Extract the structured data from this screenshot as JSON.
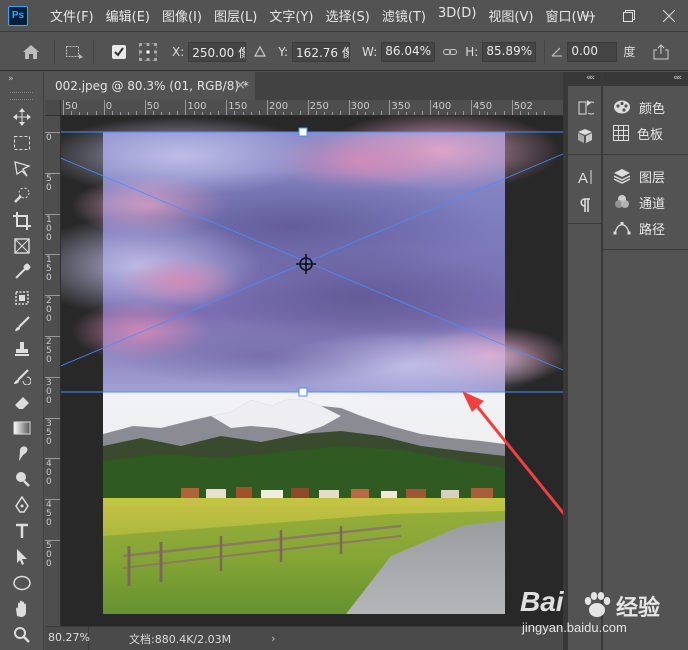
{
  "app": {
    "logo_text": "Ps"
  },
  "menu": [
    "文件(F)",
    "编辑(E)",
    "图像(I)",
    "图层(L)",
    "文字(Y)",
    "选择(S)",
    "滤镜(T)",
    "3D(D)",
    "视图(V)",
    "窗口(W)"
  ],
  "options": {
    "x_label": "X:",
    "x_value": "250.00 像素",
    "y_label": "Y:",
    "y_value": "162.76 像素",
    "w_label": "W:",
    "w_value": "86.04%",
    "h_label": "H:",
    "h_value": "85.89%",
    "angle_value": "0.00",
    "angle_unit": "度"
  },
  "toolbar": {
    "collapse": "»",
    "tools": [
      "move-tool",
      "marquee-tool",
      "lasso-tool",
      "quick-select-tool",
      "crop-tool",
      "frame-tool",
      "eyedropper-tool",
      "patch-tool",
      "brush-tool",
      "stamp-tool",
      "history-brush-tool",
      "eraser-tool",
      "gradient-tool",
      "smudge-tool",
      "dodge-tool",
      "pen-tool",
      "type-tool",
      "path-select-tool",
      "ellipse-tool",
      "hand-tool",
      "zoom-tool"
    ]
  },
  "document": {
    "tab_title": "002.jpeg @ 80.3% (01, RGB/8) *",
    "close_glyph": "×"
  },
  "ruler": {
    "h_labels": [
      "50",
      "0",
      "50",
      "100",
      "150",
      "200",
      "250",
      "300",
      "350",
      "400",
      "450",
      "502"
    ],
    "v_labels": [
      [
        "0"
      ],
      [
        "5",
        "0"
      ],
      [
        "1",
        "0",
        "0"
      ],
      [
        "1",
        "5",
        "0"
      ],
      [
        "2",
        "0",
        "0"
      ],
      [
        "2",
        "5",
        "0"
      ],
      [
        "3",
        "0",
        "0"
      ],
      [
        "3",
        "5",
        "0"
      ],
      [
        "4",
        "0",
        "0"
      ],
      [
        "4",
        "5",
        "0"
      ],
      [
        "5",
        "0",
        "0"
      ]
    ]
  },
  "status": {
    "zoom": "80.27%",
    "doc_info": "文档:880.4K/2.03M",
    "arrow": "›"
  },
  "panels": {
    "collapse": "««",
    "right_items": [
      {
        "label": "颜色",
        "icon": "palette-icon"
      },
      {
        "label": "色板",
        "icon": "swatches-icon"
      },
      {
        "label": "图层",
        "icon": "layers-icon"
      },
      {
        "label": "通道",
        "icon": "channels-icon"
      },
      {
        "label": "路径",
        "icon": "paths-icon"
      }
    ]
  },
  "watermark": {
    "brand_left": "Bai",
    "brand_right": "经验",
    "url": "jingyan.baidu.com"
  },
  "colors": {
    "accent_guide": "#4a8cff",
    "arrow_red": "#f04040",
    "ui_bg": "#535353",
    "pasteboard": "#282828"
  }
}
